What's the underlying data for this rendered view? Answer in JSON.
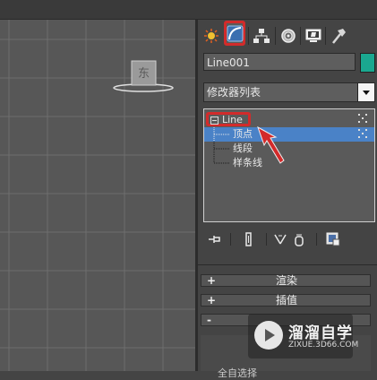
{
  "viewport": {
    "viewcube_label": "东"
  },
  "command_panel": {
    "tabs": [
      {
        "icon": "sun-icon",
        "active": false
      },
      {
        "icon": "modify-curve-icon",
        "active": true
      },
      {
        "icon": "hierarchy-icon",
        "active": false
      },
      {
        "icon": "motion-icon",
        "active": false
      },
      {
        "icon": "display-monitor-icon",
        "active": false
      },
      {
        "icon": "utilities-hammer-icon",
        "active": false
      }
    ],
    "object_name": "Line001",
    "object_color": "#1aa890",
    "modifier_list_label": "修改器列表",
    "stack": {
      "root": "Line",
      "items": [
        {
          "label": "顶点",
          "selected": true
        },
        {
          "label": "线段",
          "selected": false
        },
        {
          "label": "样条线",
          "selected": false
        }
      ]
    },
    "rollouts": [
      {
        "sign": "+",
        "title": "渲染"
      },
      {
        "sign": "+",
        "title": "插值"
      },
      {
        "sign": "-",
        "title": ""
      }
    ],
    "partial_text": "全自选择"
  },
  "watermark": {
    "title": "溜溜自学",
    "url": "ZIXUE.3D66.COM"
  },
  "colors": {
    "highlight_red": "#d22b2b",
    "selection_blue": "#4a82c7",
    "panel_bg": "#444444",
    "viewport_bg": "#575757"
  }
}
